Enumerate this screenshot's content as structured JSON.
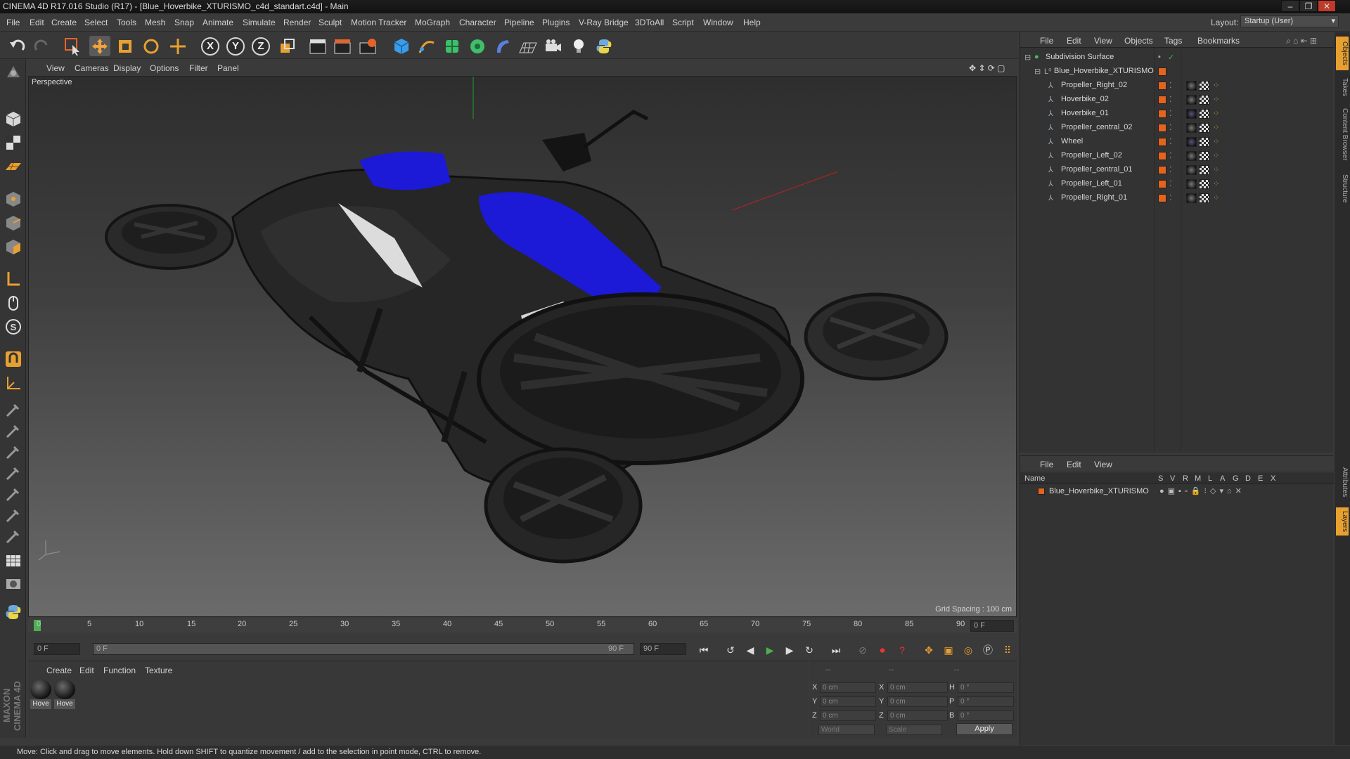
{
  "window": {
    "title": "CINEMA 4D R17.016 Studio (R17) - [Blue_Hoverbike_XTURISMO_c4d_standart.c4d] - Main",
    "controls": [
      "–",
      "❐",
      "✕"
    ]
  },
  "menubar": {
    "items": [
      "File",
      "Edit",
      "Create",
      "Select",
      "Tools",
      "Mesh",
      "Snap",
      "Animate",
      "Simulate",
      "Render",
      "Sculpt",
      "Motion Tracker",
      "MoGraph",
      "Character",
      "Pipeline",
      "Plugins",
      "V-Ray Bridge",
      "3DToAll",
      "Script",
      "Window",
      "Help"
    ],
    "layout_label": "Layout:",
    "layout_value": "Startup (User)"
  },
  "toolbar": {
    "axis_x": "X",
    "axis_y": "Y",
    "axis_z": "Z"
  },
  "viewport": {
    "menu": [
      "View",
      "Cameras",
      "Display",
      "Options",
      "Filter",
      "Panel"
    ],
    "camera_label": "Perspective",
    "grid_spacing": "Grid Spacing : 100 cm"
  },
  "timeline": {
    "ticks": [
      "0",
      "5",
      "10",
      "15",
      "20",
      "25",
      "30",
      "35",
      "40",
      "45",
      "50",
      "55",
      "60",
      "65",
      "70",
      "75",
      "80",
      "85",
      "90"
    ],
    "current_frame": "0 F"
  },
  "transport": {
    "start_field": "0 F",
    "range_start": "0 F",
    "range_end": "90 F",
    "end_field": "90 F"
  },
  "material_manager": {
    "menu": [
      "Create",
      "Edit",
      "Function",
      "Texture"
    ],
    "materials": [
      "Hove",
      "Hove"
    ]
  },
  "coordinates": {
    "header": [
      "--",
      "--",
      "--"
    ],
    "pos_labels": [
      "X",
      "Y",
      "Z"
    ],
    "size_labels": [
      "X",
      "Y",
      "Z"
    ],
    "rot_labels": [
      "H",
      "P",
      "B"
    ],
    "pos_values": [
      "0 cm",
      "0 cm",
      "0 cm"
    ],
    "size_values": [
      "0 cm",
      "0 cm",
      "0 cm"
    ],
    "rot_values": [
      "0 °",
      "0 °",
      "0 °"
    ],
    "mode_world": "World",
    "mode_scale": "Scale",
    "apply": "Apply"
  },
  "object_manager": {
    "menu": [
      "File",
      "Edit",
      "View",
      "Objects",
      "Tags",
      "Bookmarks"
    ],
    "root": "Subdivision Surface",
    "group": "Blue_Hoverbike_XTURISMO",
    "objects": [
      "Propeller_Right_02",
      "Hoverbike_02",
      "Hoverbike_01",
      "Propeller_central_02",
      "Wheel",
      "Propeller_Left_02",
      "Propeller_central_01",
      "Propeller_Left_01",
      "Propeller_Right_01"
    ]
  },
  "layer_manager": {
    "menu": [
      "File",
      "Edit",
      "View"
    ],
    "name_header": "Name",
    "columns": [
      "S",
      "V",
      "R",
      "M",
      "L",
      "A",
      "G",
      "D",
      "E",
      "X"
    ],
    "layer": "Blue_Hoverbike_XTURISMO"
  },
  "right_tabs": [
    "Objects",
    "Takes",
    "Content Browser",
    "Structure",
    "Attributes",
    "Layers"
  ],
  "status": "Move: Click and drag to move elements. Hold down SHIFT to quantize movement / add to the selection in point mode, CTRL to remove.",
  "brand": "MAXON CINEMA 4D",
  "colors": {
    "accent_orange": "#e6631e",
    "bike_blue": "#1c1ad6"
  }
}
